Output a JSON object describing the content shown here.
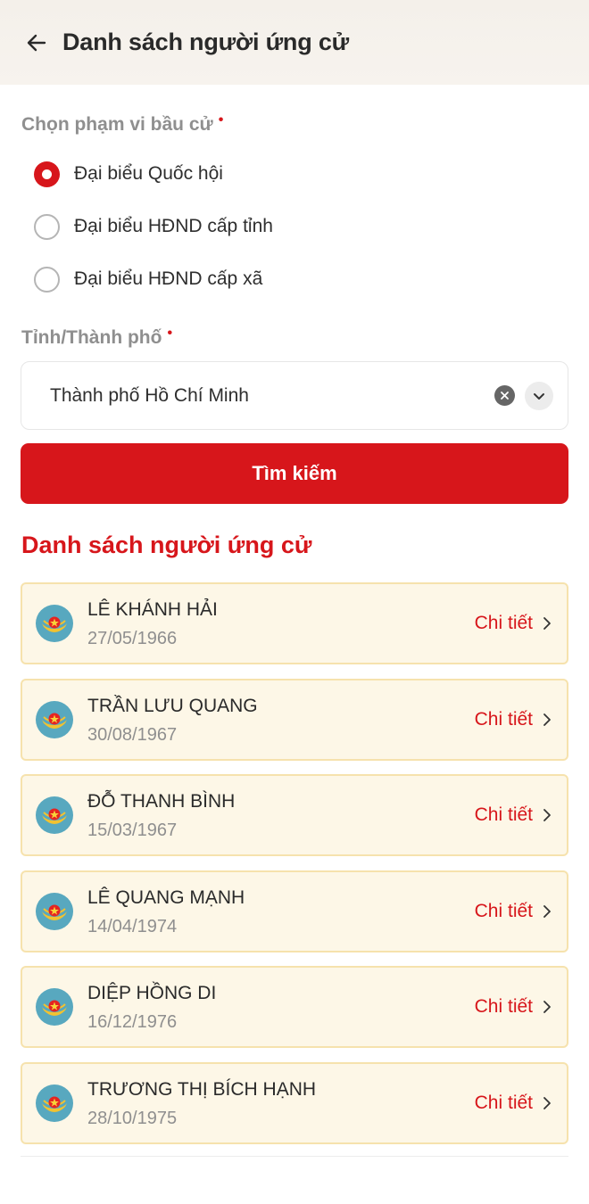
{
  "header": {
    "title": "Danh sách người ứng cử"
  },
  "scope": {
    "label": "Chọn phạm vi bầu cử",
    "required_mark": "•",
    "options": [
      {
        "label": "Đại biểu Quốc hội",
        "checked": true
      },
      {
        "label": "Đại biểu HĐND cấp tỉnh",
        "checked": false
      },
      {
        "label": "Đại biểu HĐND cấp xã",
        "checked": false
      }
    ]
  },
  "province": {
    "label": "Tỉnh/Thành phố",
    "required_mark": "•",
    "value": "Thành phố Hồ Chí Minh"
  },
  "search_button": {
    "label": "Tìm kiếm"
  },
  "list": {
    "title": "Danh sách người ứng cử",
    "detail_label": "Chi tiết",
    "items": [
      {
        "name": "LÊ KHÁNH HẢI",
        "dob": "27/05/1966"
      },
      {
        "name": "TRẦN LƯU QUANG",
        "dob": "30/08/1967"
      },
      {
        "name": "ĐỖ THANH BÌNH",
        "dob": "15/03/1967"
      },
      {
        "name": "LÊ QUANG MẠNH",
        "dob": "14/04/1974"
      },
      {
        "name": "DIỆP HỒNG DI",
        "dob": "16/12/1976"
      },
      {
        "name": "TRƯƠNG THỊ BÍCH HẠNH",
        "dob": "28/10/1975"
      }
    ]
  },
  "colors": {
    "accent": "#d7161b",
    "card_bg": "#fdf7e7",
    "card_border": "#f6e2ad",
    "emblem_bg": "#58a8bf",
    "emblem_star": "#e52421",
    "emblem_ribbon": "#f2c230"
  },
  "icons": {
    "back": "arrow-left-icon",
    "clear": "close-circle-icon",
    "dropdown": "chevron-down-icon",
    "detail": "chevron-right-icon",
    "emblem": "national-emblem-icon"
  }
}
